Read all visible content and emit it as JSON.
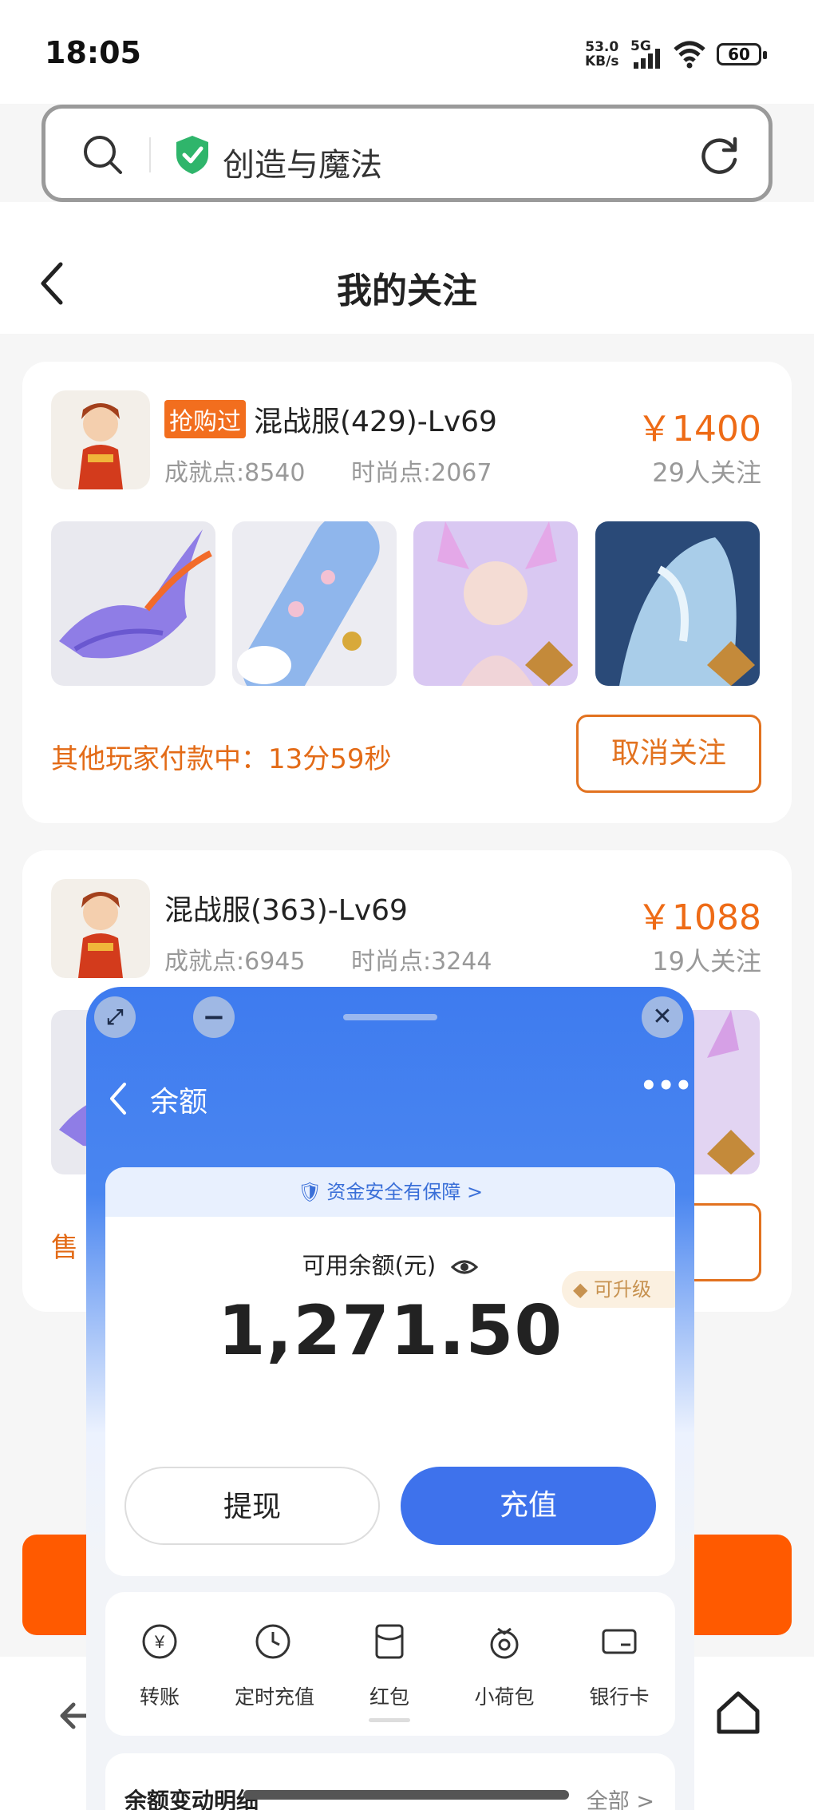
{
  "status": {
    "time": "18:05",
    "net_speed": "53.0",
    "net_unit": "KB/s",
    "signal_gen": "5G",
    "battery": "60"
  },
  "search": {
    "query": "创造与魔法"
  },
  "header": {
    "title": "我的关注"
  },
  "cards": [
    {
      "badge": "抢购过",
      "server": "混战服(429)-Lv69",
      "achievement": "成就点:8540",
      "fashion": "时尚点:2067",
      "price": "￥1400",
      "followers": "29人关注",
      "status": "其他玩家付款中：13分59秒",
      "action": "取消关注"
    },
    {
      "badge": "",
      "server": "混战服(363)-Lv69",
      "achievement": "成就点:6945",
      "fashion": "时尚点:3244",
      "price": "￥1088",
      "followers": "19人关注",
      "status_partial": "售",
      "action_partial": "注"
    }
  ],
  "wallet": {
    "title": "余额",
    "safety": "资金安全有保障 >",
    "available_label": "可用余额(元)",
    "balance": "1,271.50",
    "upgrade": "可升级",
    "withdraw": "提现",
    "recharge": "充值",
    "shortcuts": [
      "转账",
      "定时充值",
      "红包",
      "小荷包",
      "银行卡"
    ],
    "detail_title": "余额变动明细",
    "detail_all": "全部 >"
  },
  "colors": {
    "accent_orange": "#ee6b16",
    "wallet_blue": "#3e7bef",
    "primary_button": "#3e72ec"
  }
}
